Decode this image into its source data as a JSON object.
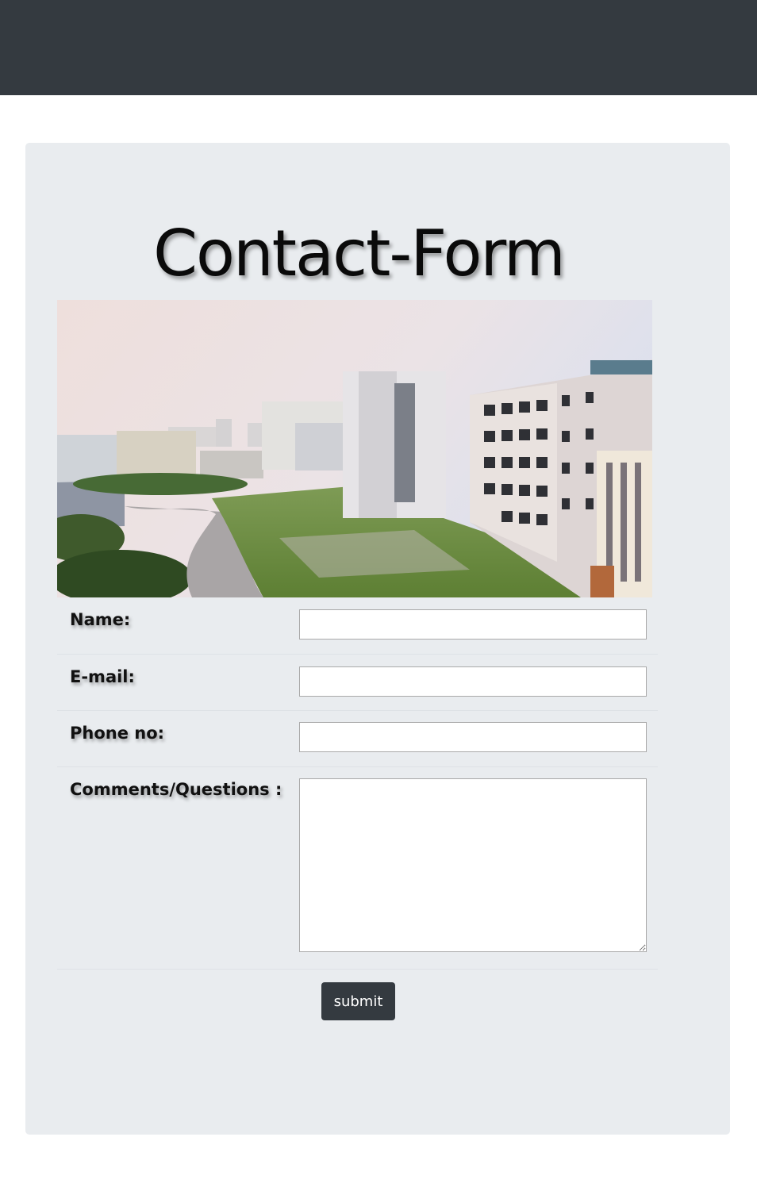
{
  "form": {
    "title": "Contact-Form",
    "fields": [
      {
        "label": "Name:",
        "value": ""
      },
      {
        "label": "E-mail:",
        "value": ""
      },
      {
        "label": "Phone no:",
        "value": ""
      },
      {
        "label": "Comments/Questions :",
        "value": ""
      }
    ],
    "submit_label": "submit"
  },
  "colors": {
    "navbar": "#343a40",
    "panel": "#e9ecef",
    "button": "#343a40",
    "button_text": "#ffffff"
  }
}
